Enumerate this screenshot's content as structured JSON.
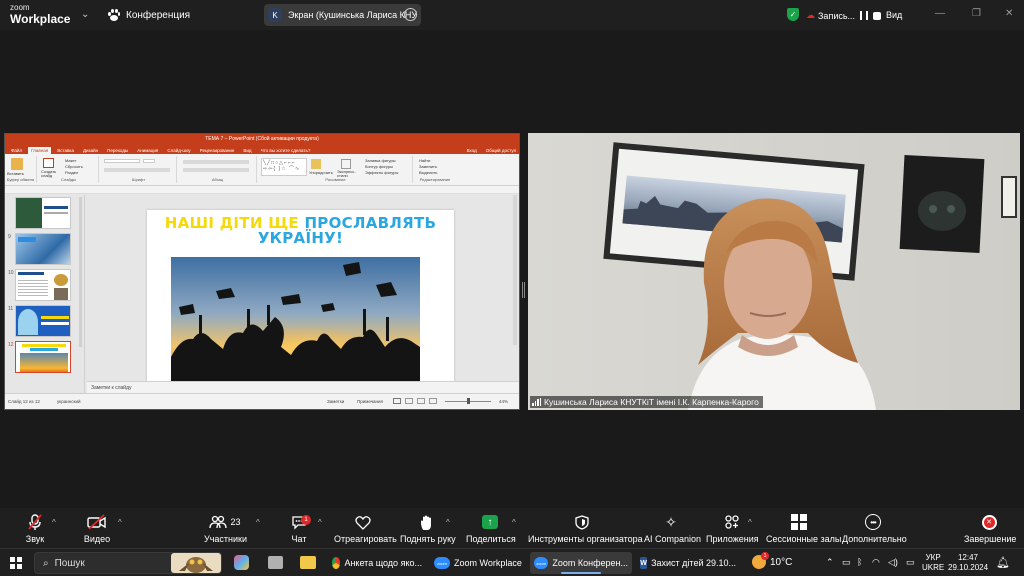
{
  "topbar": {
    "logo_line1": "zoom",
    "logo_line2": "Workplace",
    "conference_label": "Конференция",
    "share_initial": "K",
    "share_label": "Экран (Кушинська Лариса КНУ",
    "record_label": "Запись...",
    "view_label": "Вид"
  },
  "presentation": {
    "title_bar": "ТЕМА 7 – PowerPoint (Сбой активации продукта)",
    "tabs": [
      "Файл",
      "Главная",
      "Вставка",
      "Дизайн",
      "Переходы",
      "Анимация",
      "Слайд-шоу",
      "Рецензирование",
      "Вид",
      "Что вы хотите сделать?"
    ],
    "active_tab": "Главная",
    "right_tabs": [
      "Вход",
      "Общий доступ"
    ],
    "ribbon_groups": [
      "Буфер обмена",
      "Слайды",
      "Шрифт",
      "Абзац",
      "Рисование",
      "Редактирование"
    ],
    "ribbon_buttons": {
      "paste": "Вставить",
      "new_slide": "Создать слайд",
      "layout": "Макет",
      "reset": "Сбросить",
      "section": "Раздел",
      "arrange": "Упорядочить",
      "quick_styles": "Экспресс-стили",
      "fill": "Заливка фигуры",
      "outline": "Контур фигуры",
      "effects": "Эффекты фигуры",
      "find": "Найти",
      "replace": "Заменить",
      "select": "Выделить"
    },
    "slide_numbers": [
      "9",
      "10",
      "11",
      "12"
    ],
    "slide_title_part1": "НАШІ ДІТИ ЩЕ ",
    "slide_title_part2": "ПРОСЛАВЛЯТЬ",
    "slide_title_line2": "УКРАЇНУ!",
    "notes_placeholder": "Заметки к слайду",
    "status_slide": "Слайд 12 из 12",
    "status_lang": "украинский",
    "status_notes": "Заметки",
    "status_comments": "Примечания",
    "zoom": "44%"
  },
  "video": {
    "participant_name": "Кушинська Лариса КНУТКіТ імені І.К. Карпенка-Карого"
  },
  "toolbar": {
    "audio": "Звук",
    "video": "Видео",
    "participants": "Участники",
    "participants_count": "23",
    "chat": "Чат",
    "chat_badge": "1",
    "react": "Отреагировать",
    "raise_hand": "Поднять руку",
    "share": "Поделиться",
    "host_tools": "Инструменты организатора",
    "ai_companion": "AI Companion",
    "apps": "Приложения",
    "breakout": "Сессионные залы",
    "more": "Дополнительно",
    "end": "Завершение"
  },
  "taskbar": {
    "search_label": "Пошук",
    "apps": [
      {
        "label": "Анкета щодо яко..."
      },
      {
        "label": "Zoom Workplace"
      },
      {
        "label": "Zoom Конферен..."
      },
      {
        "label": "Захист дітей 29.10..."
      }
    ],
    "weather": "10°C",
    "lang_top": "УКР",
    "lang_bottom": "UKRE",
    "time": "12:47",
    "date": "29.10.2024",
    "notif_badge": "1"
  },
  "colors": {
    "ppt_red": "#c43e1c",
    "title_yellow": "#f5d90b",
    "title_blue": "#2aa6e0",
    "end_red": "#e02828",
    "share_green": "#1aa34a"
  }
}
